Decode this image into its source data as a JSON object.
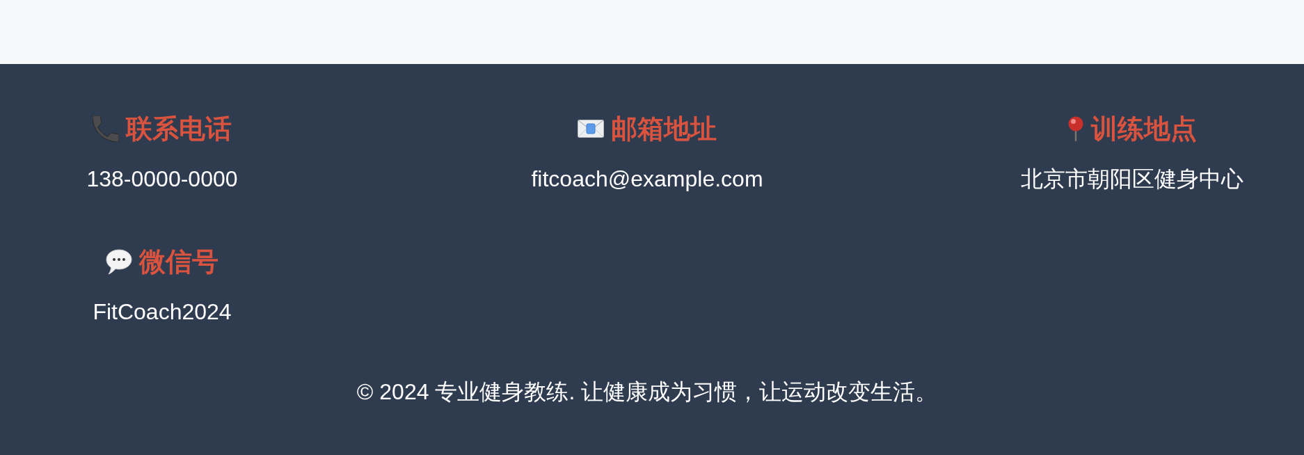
{
  "contacts": [
    {
      "kind": "phone",
      "title": "联系电话",
      "value": "138-0000-0000"
    },
    {
      "kind": "email",
      "title": "邮箱地址",
      "value": "fitcoach@example.com"
    },
    {
      "kind": "location",
      "title": "训练地点",
      "value": "北京市朝阳区健身中心"
    },
    {
      "kind": "wechat",
      "title": "微信号",
      "value": "FitCoach2024"
    }
  ],
  "copyright": "© 2024 专业健身教练. 让健康成为习惯，让运动改变生活。"
}
